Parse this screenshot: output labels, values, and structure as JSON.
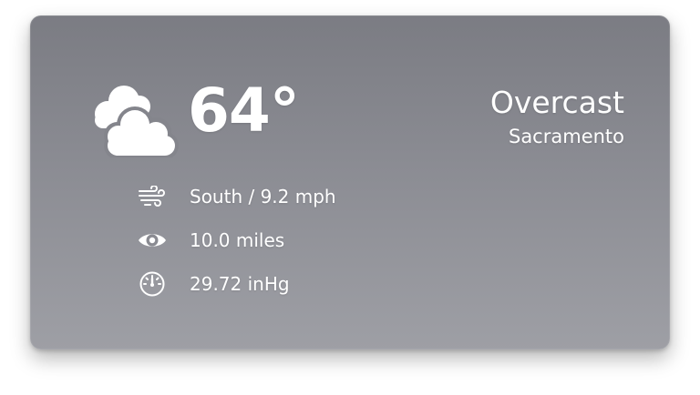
{
  "weather": {
    "condition_icon": "cloudy-icon",
    "temperature": "64°",
    "condition": "Overcast",
    "city": "Sacramento"
  },
  "details": {
    "wind": {
      "icon": "wind-icon",
      "text": "South / 9.2 mph"
    },
    "visibility": {
      "icon": "eye-icon",
      "text": "10.0 miles"
    },
    "pressure": {
      "icon": "gauge-icon",
      "text": "29.72 inHg"
    }
  },
  "colors": {
    "card_top": "#7b7c83",
    "card_bottom": "#9e9fa5",
    "text": "#ffffff"
  }
}
